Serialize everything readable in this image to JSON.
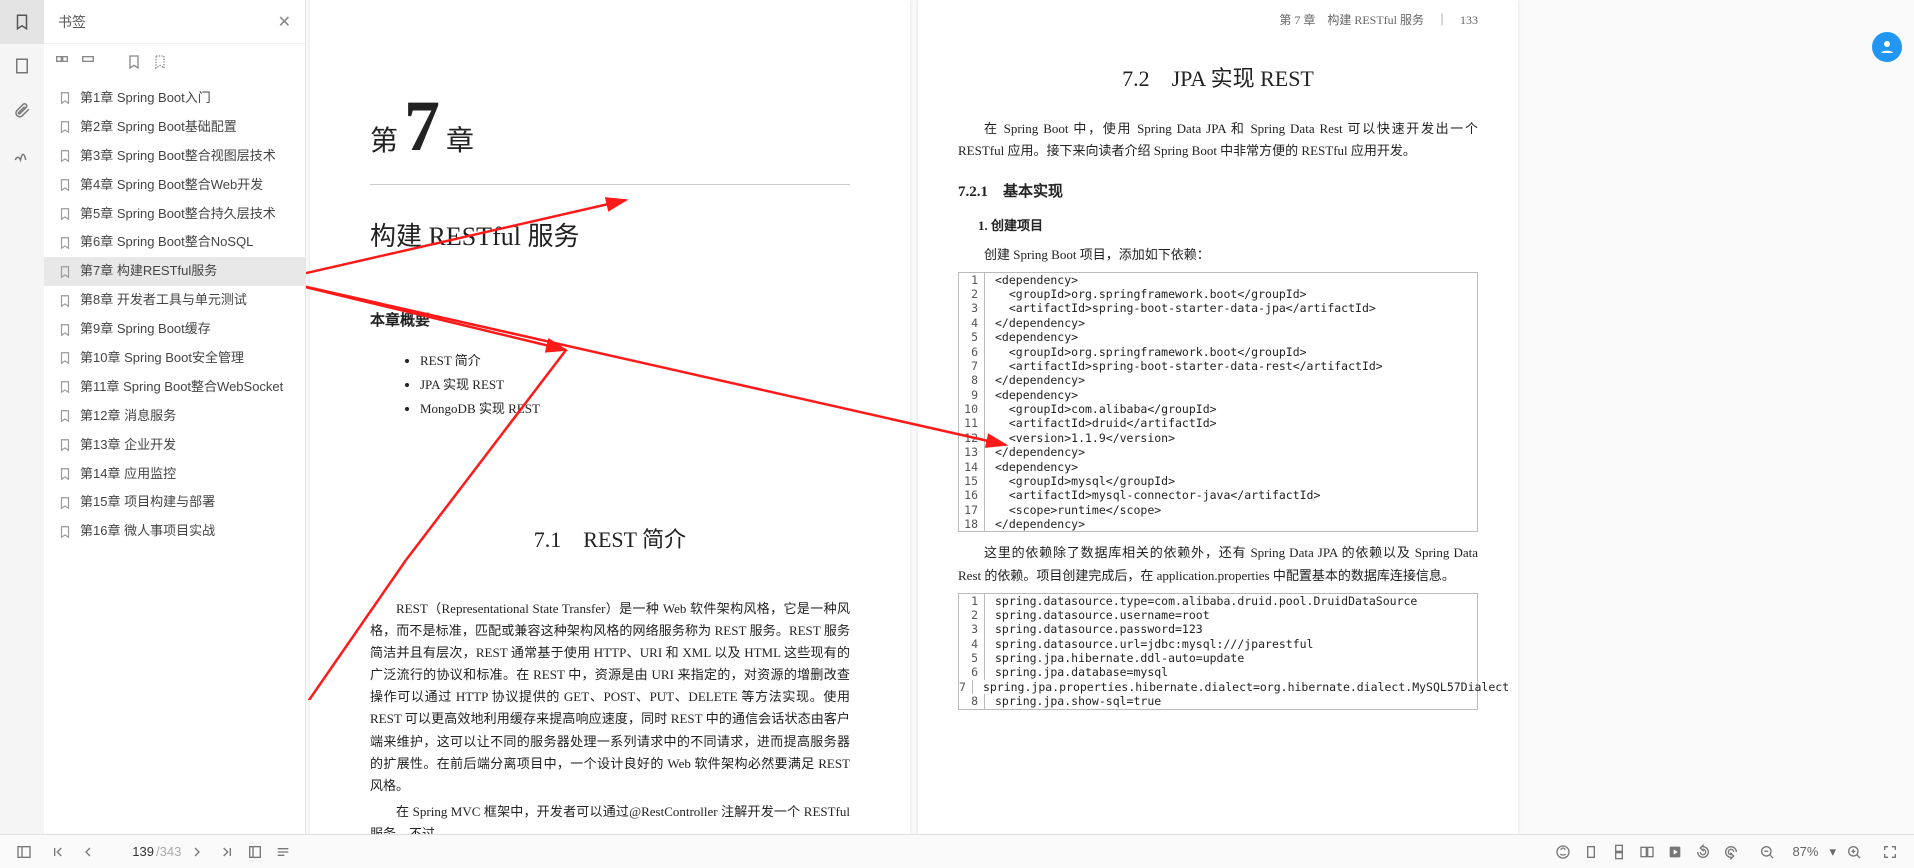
{
  "sidebar": {
    "title": "书签",
    "bookmarks": [
      "第1章 Spring Boot入门",
      "第2章 Spring Boot基础配置",
      "第3章 Spring Boot整合视图层技术",
      "第4章 Spring Boot整合Web开发",
      "第5章 Spring Boot整合持久层技术",
      "第6章 Spring Boot整合NoSQL",
      "第7章 构建RESTful服务",
      "第8章 开发者工具与单元测试",
      "第9章 Spring Boot缓存",
      "第10章 Spring Boot安全管理",
      "第11章 Spring Boot整合WebSocket",
      "第12章 消息服务",
      "第13章 企业开发",
      "第14章 应用监控",
      "第15章 项目构建与部署",
      "第16章 微人事项目实战"
    ],
    "active_index": 6
  },
  "left_page": {
    "chapter_prefix": "第",
    "chapter_number": "7",
    "chapter_suffix": "章",
    "chapter_title": "构建 RESTful 服务",
    "gist_heading": "本章概要",
    "bullets": [
      "REST 简介",
      "JPA 实现 REST",
      "MongoDB 实现 REST"
    ],
    "sec71_title": "7.1　REST 简介",
    "para1": "REST（Representational State Transfer）是一种 Web 软件架构风格，它是一种风格，而不是标准，匹配或兼容这种架构风格的网络服务称为 REST 服务。REST 服务简洁并且有层次，REST 通常基于使用 HTTP、URI 和 XML 以及 HTML 这些现有的广泛流行的协议和标准。在 REST 中，资源是由 URI 来指定的，对资源的增删改查操作可以通过 HTTP 协议提供的 GET、POST、PUT、DELETE 等方法实现。使用 REST 可以更高效地利用缓存来提高响应速度，同时 REST 中的通信会话状态由客户端来维护，这可以让不同的服务器处理一系列请求中的不同请求，进而提高服务器的扩展性。在前后端分离项目中，一个设计良好的 Web 软件架构必然要满足 REST 风格。",
    "para2": "在 Spring MVC 框架中，开发者可以通过@RestController 注解开发一个 RESTful 服务，不过，"
  },
  "right_page": {
    "header": "第 7 章　构建 RESTful 服务　｜　133",
    "sec72_title": "7.2　JPA 实现 REST",
    "intro": "在 Spring Boot 中，使用 Spring Data JPA 和 Spring Data Rest 可以快速开发出一个 RESTful 应用。接下来向读者介绍 Spring Boot 中非常方便的 RESTful 应用开发。",
    "sec721_title": "7.2.1　基本实现",
    "step1": "1. 创建项目",
    "step1_desc": "创建 Spring Boot 项目，添加如下依赖：",
    "code1": [
      "<dependency>",
      "  <groupId>org.springframework.boot</groupId>",
      "  <artifactId>spring-boot-starter-data-jpa</artifactId>",
      "</dependency>",
      "<dependency>",
      "  <groupId>org.springframework.boot</groupId>",
      "  <artifactId>spring-boot-starter-data-rest</artifactId>",
      "</dependency>",
      "<dependency>",
      "  <groupId>com.alibaba</groupId>",
      "  <artifactId>druid</artifactId>",
      "  <version>1.1.9</version>",
      "</dependency>",
      "<dependency>",
      "  <groupId>mysql</groupId>",
      "  <artifactId>mysql-connector-java</artifactId>",
      "  <scope>runtime</scope>",
      "</dependency>"
    ],
    "after_code1": "这里的依赖除了数据库相关的依赖外，还有 Spring Data JPA 的依赖以及 Spring Data Rest 的依赖。项目创建完成后，在 application.properties 中配置基本的数据库连接信息。",
    "code2": [
      "spring.datasource.type=com.alibaba.druid.pool.DruidDataSource",
      "spring.datasource.username=root",
      "spring.datasource.password=123",
      "spring.datasource.url=jdbc:mysql:///jparestful",
      "spring.jpa.hibernate.ddl-auto=update",
      "spring.jpa.database=mysql",
      "spring.jpa.properties.hibernate.dialect=org.hibernate.dialect.MySQL57Dialect",
      "spring.jpa.show-sql=true"
    ]
  },
  "status": {
    "current_page": "139",
    "total_pages": "/343",
    "zoom": "87%"
  }
}
